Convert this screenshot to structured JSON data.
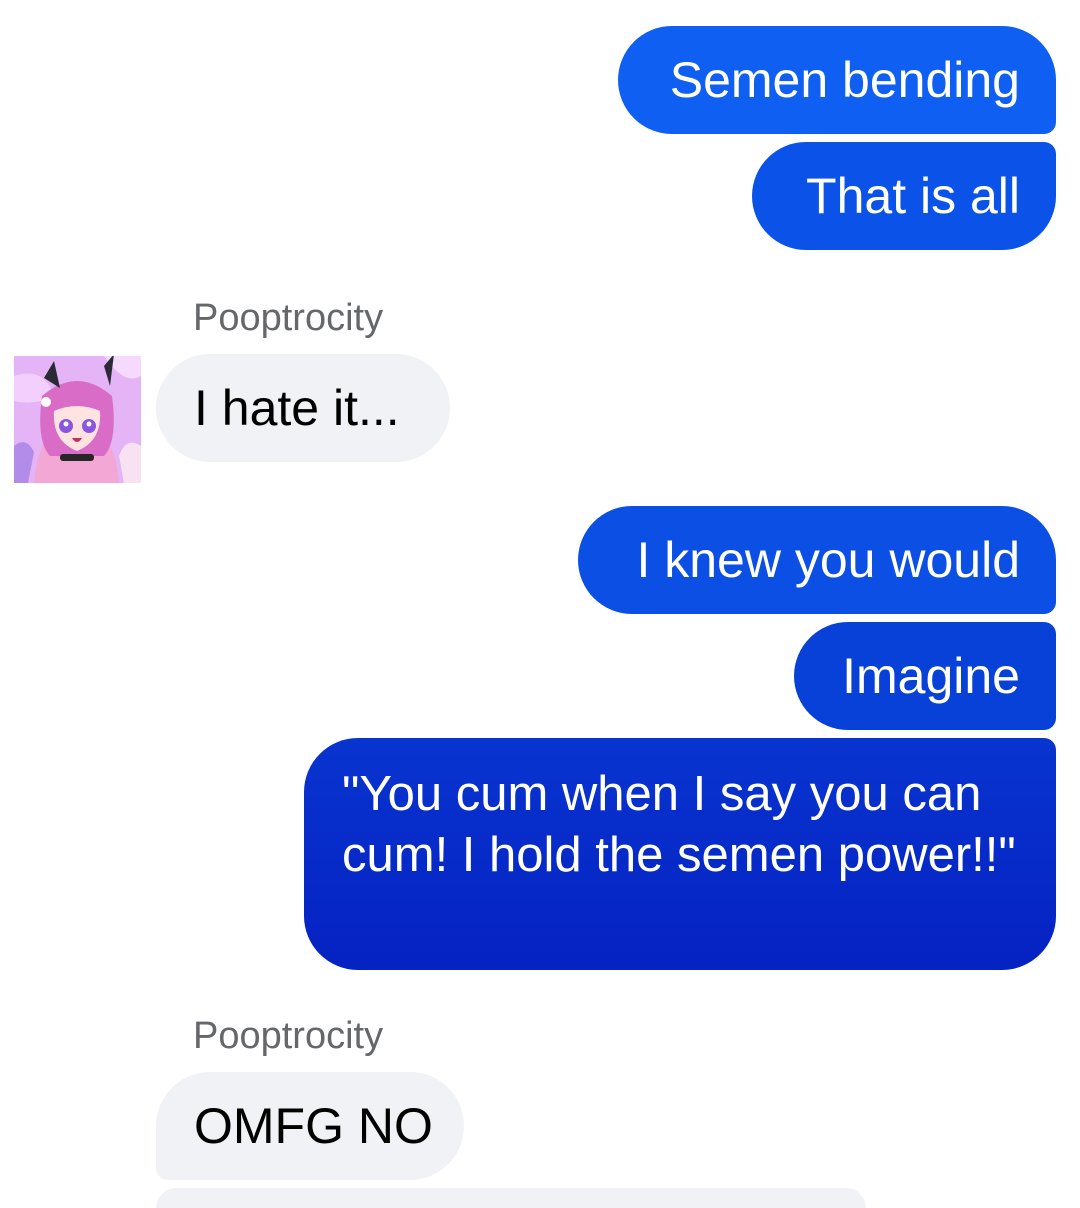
{
  "messages": {
    "m1": "Semen bending",
    "m2": "That is all",
    "sender1": "Pooptrocity",
    "m3": "I hate it...",
    "m4": "I knew you would",
    "m5": "Imagine",
    "m6": "\"You cum when I say you can cum! I hold the semen power!!\"",
    "sender2": "Pooptrocity",
    "m7": "OMFG NO"
  },
  "avatar": {
    "icon": "avatar-anime-girl-icon"
  },
  "colors": {
    "outgoing_top": "#0f62f6",
    "outgoing_bottom": "#0826c4",
    "incoming_bg": "#f0f2f5",
    "sender_name": "#65676b"
  }
}
